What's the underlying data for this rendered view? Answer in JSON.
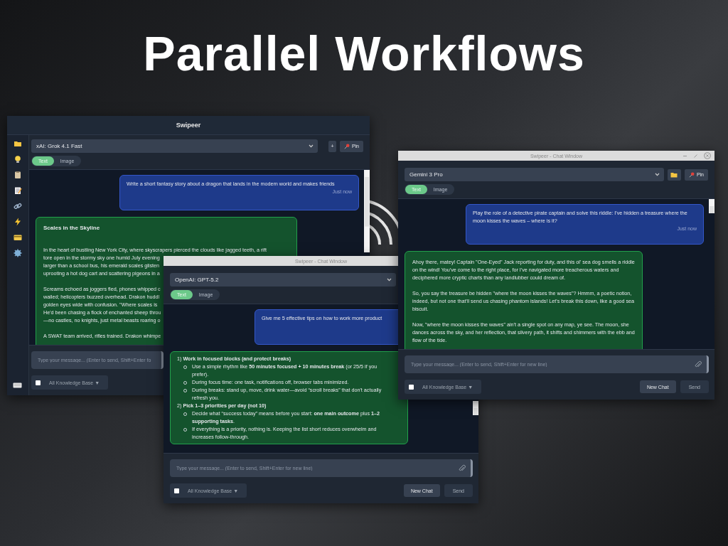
{
  "headline": "Parallel Workflows",
  "windows": [
    {
      "kind": "main",
      "title": "Swipeer",
      "model": "xAI: Grok 4.1 Fast",
      "header_buttons": [
        {
          "kind": "add",
          "label": "+"
        },
        {
          "kind": "pin",
          "label": "Pin"
        }
      ],
      "tabs": [
        {
          "label": "Text",
          "selected": true
        },
        {
          "label": "Image",
          "selected": false
        }
      ],
      "messages": [
        {
          "kind": "user",
          "text": "Write a short fantasy story about a dragon that lands in the modern world and makes friends",
          "time": "Just now"
        },
        {
          "kind": "story",
          "title": "Scales in the Skyline",
          "paragraphs": [
            [
              "In the heart of bustling New York City, where skyscrapers pierced the clouds like jagged teeth, a rift",
              "tore open in the stormy sky one humid July evening",
              "larger than a school bus, his emerald scales glisten",
              "uprooting a hot dog cart and scattering pigeons in a"
            ],
            [
              "Screams echoed as joggers fled, phones whipped c",
              "wailed; helicopters buzzed overhead. Drakon huddl",
              "golden eyes wide with confusion. \"Where scales is",
              "He'd been chasing a flock of enchanted sheep throu",
              "—no castles, no knights, just metal beasts roaring o"
            ],
            [
              "A SWAT team arrived, rifles trained. Drakon whimpe"
            ]
          ]
        }
      ],
      "input": {
        "placeholder": "Type your message... (Enter to send, Shift+Enter fo"
      },
      "knowledge_base": {
        "checked": false,
        "label": "All Knowledge Base ▼"
      }
    },
    {
      "kind": "chat",
      "title": "Swipeer - Chat Window",
      "model": "OpenAI: GPT-5.2",
      "tabs": [
        {
          "label": "Text",
          "selected": true
        },
        {
          "label": "Image",
          "selected": false
        }
      ],
      "messages": [
        {
          "kind": "user",
          "text": "Give me 5 effective tips on how to work more product"
        },
        {
          "kind": "list",
          "sections": [
            {
              "heading": "1) **Work in focused blocks (and protect breaks)**",
              "bullets": [
                "Use a simple rhythm like **50 minutes focused + 10 minutes break** (or 25/5 if you prefer).",
                "During focus time: one task, notifications off, browser tabs minimized.",
                "During breaks: stand up, move, drink water—avoid “scroll breaks” that don't actually refresh you."
              ]
            },
            {
              "heading": "2) **Pick 1–3 priorities per day (not 10)**",
              "bullets": [
                "Decide what “success today” means before you start: **one main outcome** plus **1–2 supporting tasks**.",
                "If everything is a priority, nothing is. Keeping the list short reduces overwhelm and increases follow-through."
              ]
            }
          ]
        }
      ],
      "input": {
        "placeholder": "Type your message... (Enter to send, Shift+Enter for new line)"
      },
      "knowledge_base": {
        "checked": false,
        "label": "All Knowledge Base ▼"
      },
      "buttons": [
        {
          "kind": "new_chat",
          "label": "New Chat"
        },
        {
          "kind": "send",
          "label": "Send"
        }
      ]
    },
    {
      "kind": "chat",
      "title": "Swipeer - Chat Window",
      "window_controls": true,
      "model": "Gemini 3 Pro",
      "header_buttons": [
        {
          "kind": "folder"
        },
        {
          "kind": "pin",
          "label": "Pin"
        }
      ],
      "tabs": [
        {
          "label": "Text",
          "selected": true
        },
        {
          "label": "Image",
          "selected": false
        }
      ],
      "messages": [
        {
          "kind": "user",
          "text": "Play the role of a detective pirate captain and solve this riddle: I've hidden a treasure where the moon kisses the waves – where is it?",
          "time": "Just now"
        },
        {
          "kind": "prose",
          "paragraphs": [
            "Ahoy there, matey! Captain \"One-Eyed\" Jack reporting for duty, and this ol' sea dog smells a riddle on the wind! You've come to the right place, for I've navigated more treacherous waters and deciphered more cryptic charts than any landlubber could dream of.",
            "So, you say the treasure be hidden \"where the moon kisses the waves\"? Hmmm, a poetic notion, indeed, but not one that'll send us chasing phantom islands! Let's break this down, like a good sea biscuit.",
            "Now, \"where the moon kisses the waves\" ain't a single spot on any map, ye see. The moon, she dances across the sky, and her reflection, that silvery path, it shifts and shimmers with the ebb and flow of the tide."
          ]
        }
      ],
      "input": {
        "placeholder": "Type your message... (Enter to send, Shift+Enter for new line)"
      },
      "knowledge_base": {
        "checked": false,
        "label": "All Knowledge Base ▼"
      },
      "buttons": [
        {
          "kind": "new_chat",
          "label": "New Chat"
        },
        {
          "kind": "send",
          "label": "Send"
        }
      ]
    }
  ]
}
